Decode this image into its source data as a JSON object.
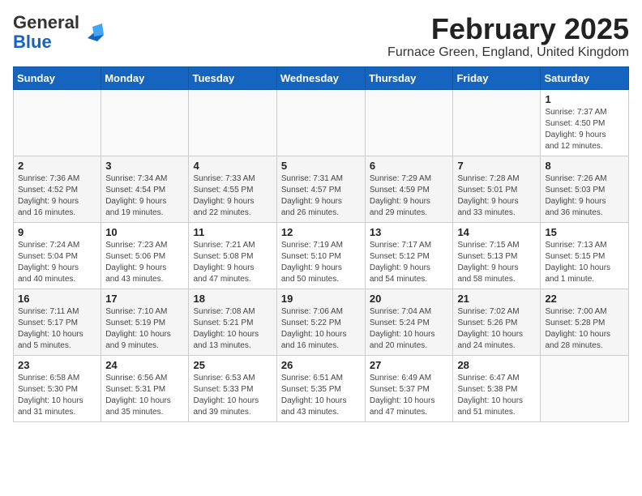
{
  "header": {
    "logo_general": "General",
    "logo_blue": "Blue",
    "month_title": "February 2025",
    "location": "Furnace Green, England, United Kingdom"
  },
  "weekdays": [
    "Sunday",
    "Monday",
    "Tuesday",
    "Wednesday",
    "Thursday",
    "Friday",
    "Saturday"
  ],
  "weeks": [
    [
      {
        "day": "",
        "info": ""
      },
      {
        "day": "",
        "info": ""
      },
      {
        "day": "",
        "info": ""
      },
      {
        "day": "",
        "info": ""
      },
      {
        "day": "",
        "info": ""
      },
      {
        "day": "",
        "info": ""
      },
      {
        "day": "1",
        "info": "Sunrise: 7:37 AM\nSunset: 4:50 PM\nDaylight: 9 hours\nand 12 minutes."
      }
    ],
    [
      {
        "day": "2",
        "info": "Sunrise: 7:36 AM\nSunset: 4:52 PM\nDaylight: 9 hours\nand 16 minutes."
      },
      {
        "day": "3",
        "info": "Sunrise: 7:34 AM\nSunset: 4:54 PM\nDaylight: 9 hours\nand 19 minutes."
      },
      {
        "day": "4",
        "info": "Sunrise: 7:33 AM\nSunset: 4:55 PM\nDaylight: 9 hours\nand 22 minutes."
      },
      {
        "day": "5",
        "info": "Sunrise: 7:31 AM\nSunset: 4:57 PM\nDaylight: 9 hours\nand 26 minutes."
      },
      {
        "day": "6",
        "info": "Sunrise: 7:29 AM\nSunset: 4:59 PM\nDaylight: 9 hours\nand 29 minutes."
      },
      {
        "day": "7",
        "info": "Sunrise: 7:28 AM\nSunset: 5:01 PM\nDaylight: 9 hours\nand 33 minutes."
      },
      {
        "day": "8",
        "info": "Sunrise: 7:26 AM\nSunset: 5:03 PM\nDaylight: 9 hours\nand 36 minutes."
      }
    ],
    [
      {
        "day": "9",
        "info": "Sunrise: 7:24 AM\nSunset: 5:04 PM\nDaylight: 9 hours\nand 40 minutes."
      },
      {
        "day": "10",
        "info": "Sunrise: 7:23 AM\nSunset: 5:06 PM\nDaylight: 9 hours\nand 43 minutes."
      },
      {
        "day": "11",
        "info": "Sunrise: 7:21 AM\nSunset: 5:08 PM\nDaylight: 9 hours\nand 47 minutes."
      },
      {
        "day": "12",
        "info": "Sunrise: 7:19 AM\nSunset: 5:10 PM\nDaylight: 9 hours\nand 50 minutes."
      },
      {
        "day": "13",
        "info": "Sunrise: 7:17 AM\nSunset: 5:12 PM\nDaylight: 9 hours\nand 54 minutes."
      },
      {
        "day": "14",
        "info": "Sunrise: 7:15 AM\nSunset: 5:13 PM\nDaylight: 9 hours\nand 58 minutes."
      },
      {
        "day": "15",
        "info": "Sunrise: 7:13 AM\nSunset: 5:15 PM\nDaylight: 10 hours\nand 1 minute."
      }
    ],
    [
      {
        "day": "16",
        "info": "Sunrise: 7:11 AM\nSunset: 5:17 PM\nDaylight: 10 hours\nand 5 minutes."
      },
      {
        "day": "17",
        "info": "Sunrise: 7:10 AM\nSunset: 5:19 PM\nDaylight: 10 hours\nand 9 minutes."
      },
      {
        "day": "18",
        "info": "Sunrise: 7:08 AM\nSunset: 5:21 PM\nDaylight: 10 hours\nand 13 minutes."
      },
      {
        "day": "19",
        "info": "Sunrise: 7:06 AM\nSunset: 5:22 PM\nDaylight: 10 hours\nand 16 minutes."
      },
      {
        "day": "20",
        "info": "Sunrise: 7:04 AM\nSunset: 5:24 PM\nDaylight: 10 hours\nand 20 minutes."
      },
      {
        "day": "21",
        "info": "Sunrise: 7:02 AM\nSunset: 5:26 PM\nDaylight: 10 hours\nand 24 minutes."
      },
      {
        "day": "22",
        "info": "Sunrise: 7:00 AM\nSunset: 5:28 PM\nDaylight: 10 hours\nand 28 minutes."
      }
    ],
    [
      {
        "day": "23",
        "info": "Sunrise: 6:58 AM\nSunset: 5:30 PM\nDaylight: 10 hours\nand 31 minutes."
      },
      {
        "day": "24",
        "info": "Sunrise: 6:56 AM\nSunset: 5:31 PM\nDaylight: 10 hours\nand 35 minutes."
      },
      {
        "day": "25",
        "info": "Sunrise: 6:53 AM\nSunset: 5:33 PM\nDaylight: 10 hours\nand 39 minutes."
      },
      {
        "day": "26",
        "info": "Sunrise: 6:51 AM\nSunset: 5:35 PM\nDaylight: 10 hours\nand 43 minutes."
      },
      {
        "day": "27",
        "info": "Sunrise: 6:49 AM\nSunset: 5:37 PM\nDaylight: 10 hours\nand 47 minutes."
      },
      {
        "day": "28",
        "info": "Sunrise: 6:47 AM\nSunset: 5:38 PM\nDaylight: 10 hours\nand 51 minutes."
      },
      {
        "day": "",
        "info": ""
      }
    ]
  ]
}
